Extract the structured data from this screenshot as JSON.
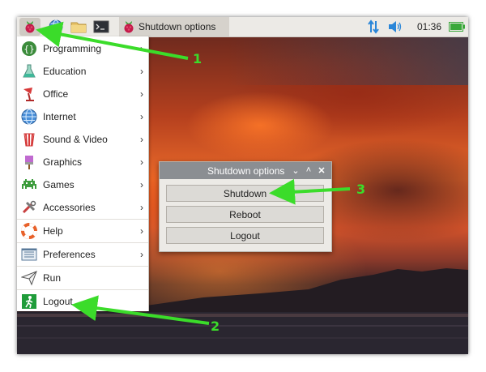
{
  "taskbar": {
    "launchers": [
      {
        "icon": "raspberry-icon"
      },
      {
        "icon": "globe-icon"
      },
      {
        "icon": "folder-icon"
      },
      {
        "icon": "terminal-icon"
      }
    ],
    "task": {
      "icon": "raspberry-icon",
      "label": "Shutdown options"
    },
    "tray": {
      "network_icon": "network-updown-icon",
      "volume_icon": "volume-icon",
      "clock": "01:36",
      "battery_icon": "battery-icon"
    }
  },
  "menu": {
    "items": [
      {
        "label": "Programming",
        "icon": "programming-icon",
        "submenu": true
      },
      {
        "label": "Education",
        "icon": "education-flask-icon",
        "submenu": true
      },
      {
        "label": "Office",
        "icon": "office-icon",
        "submenu": true
      },
      {
        "label": "Internet",
        "icon": "internet-globe-icon",
        "submenu": true
      },
      {
        "label": "Sound & Video",
        "icon": "sound-video-icon",
        "submenu": true
      },
      {
        "label": "Graphics",
        "icon": "graphics-brush-icon",
        "submenu": true
      },
      {
        "label": "Games",
        "icon": "games-invader-icon",
        "submenu": true
      },
      {
        "label": "Accessories",
        "icon": "accessories-icon",
        "submenu": true
      },
      {
        "label": "Help",
        "icon": "help-lifebuoy-icon",
        "submenu": true
      },
      {
        "label": "Preferences",
        "icon": "preferences-icon",
        "submenu": true
      },
      {
        "label": "Run",
        "icon": "run-paperplane-icon",
        "submenu": false
      },
      {
        "label": "Logout",
        "icon": "logout-exit-icon",
        "submenu": false
      }
    ]
  },
  "dialog": {
    "title": "Shutdown options",
    "buttons": {
      "shutdown": "Shutdown",
      "reboot": "Reboot",
      "logout": "Logout"
    }
  },
  "callouts": [
    "1",
    "2",
    "3"
  ],
  "colors": {
    "callout": "#3bdc2a",
    "taskbar": "#eceae6",
    "dialog_titlebar": "#8b8e92",
    "raspberry": "#c51a4a"
  }
}
